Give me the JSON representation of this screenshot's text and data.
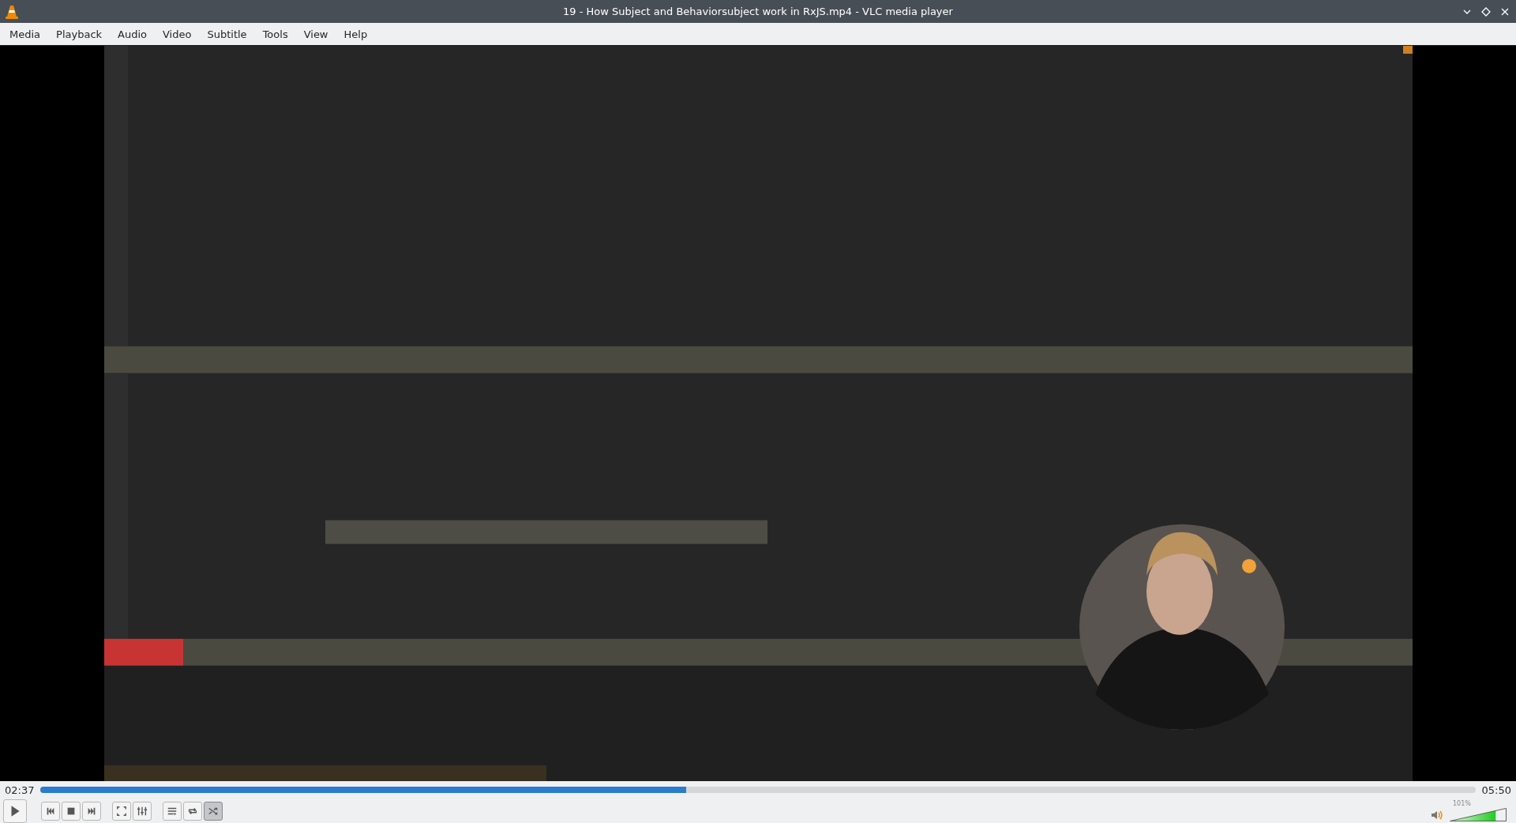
{
  "window": {
    "title": "19 - How Subject and Behaviorsubject work in RxJS.mp4 - VLC media player"
  },
  "menu": [
    "Media",
    "Playback",
    "Audio",
    "Video",
    "Subtitle",
    "Tools",
    "View",
    "Help"
  ],
  "video": {
    "kind": "picture"
  },
  "seek": {
    "elapsed": "02:37",
    "total": "05:50",
    "level": 0.45
  },
  "control_groups": [
    [
      {
        "kind": "play"
      }
    ],
    [
      {
        "kind": "previous"
      },
      {
        "kind": "stop"
      },
      {
        "kind": "next"
      }
    ],
    [
      {
        "kind": "fullscreen"
      },
      {
        "kind": "equalizer"
      }
    ],
    [
      {
        "kind": "playlist"
      },
      {
        "kind": "loop",
        "on": false
      },
      {
        "kind": "shuffle",
        "on": true
      }
    ]
  ],
  "volume": {
    "reading": "101%",
    "level": 0.81
  }
}
